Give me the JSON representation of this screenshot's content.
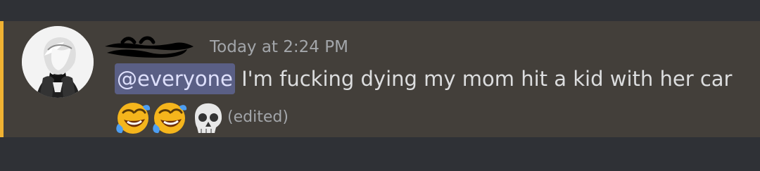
{
  "message": {
    "timestamp": "Today at 2:24 PM",
    "mention": "@everyone",
    "text": " I'm fucking dying my mom hit a kid with her car",
    "emojis": [
      "rofl-emoji",
      "rofl-emoji",
      "skull-emoji"
    ],
    "edited_label": "(edited)"
  },
  "colors": {
    "background": "#2f3136",
    "highlighted_message_background": "#433f3a",
    "mention_bar": "#f0b232",
    "mention_background": "#5a5f85",
    "mention_text": "#dee0fc",
    "message_text": "#dcddde",
    "muted_text": "#a3a6aa"
  }
}
